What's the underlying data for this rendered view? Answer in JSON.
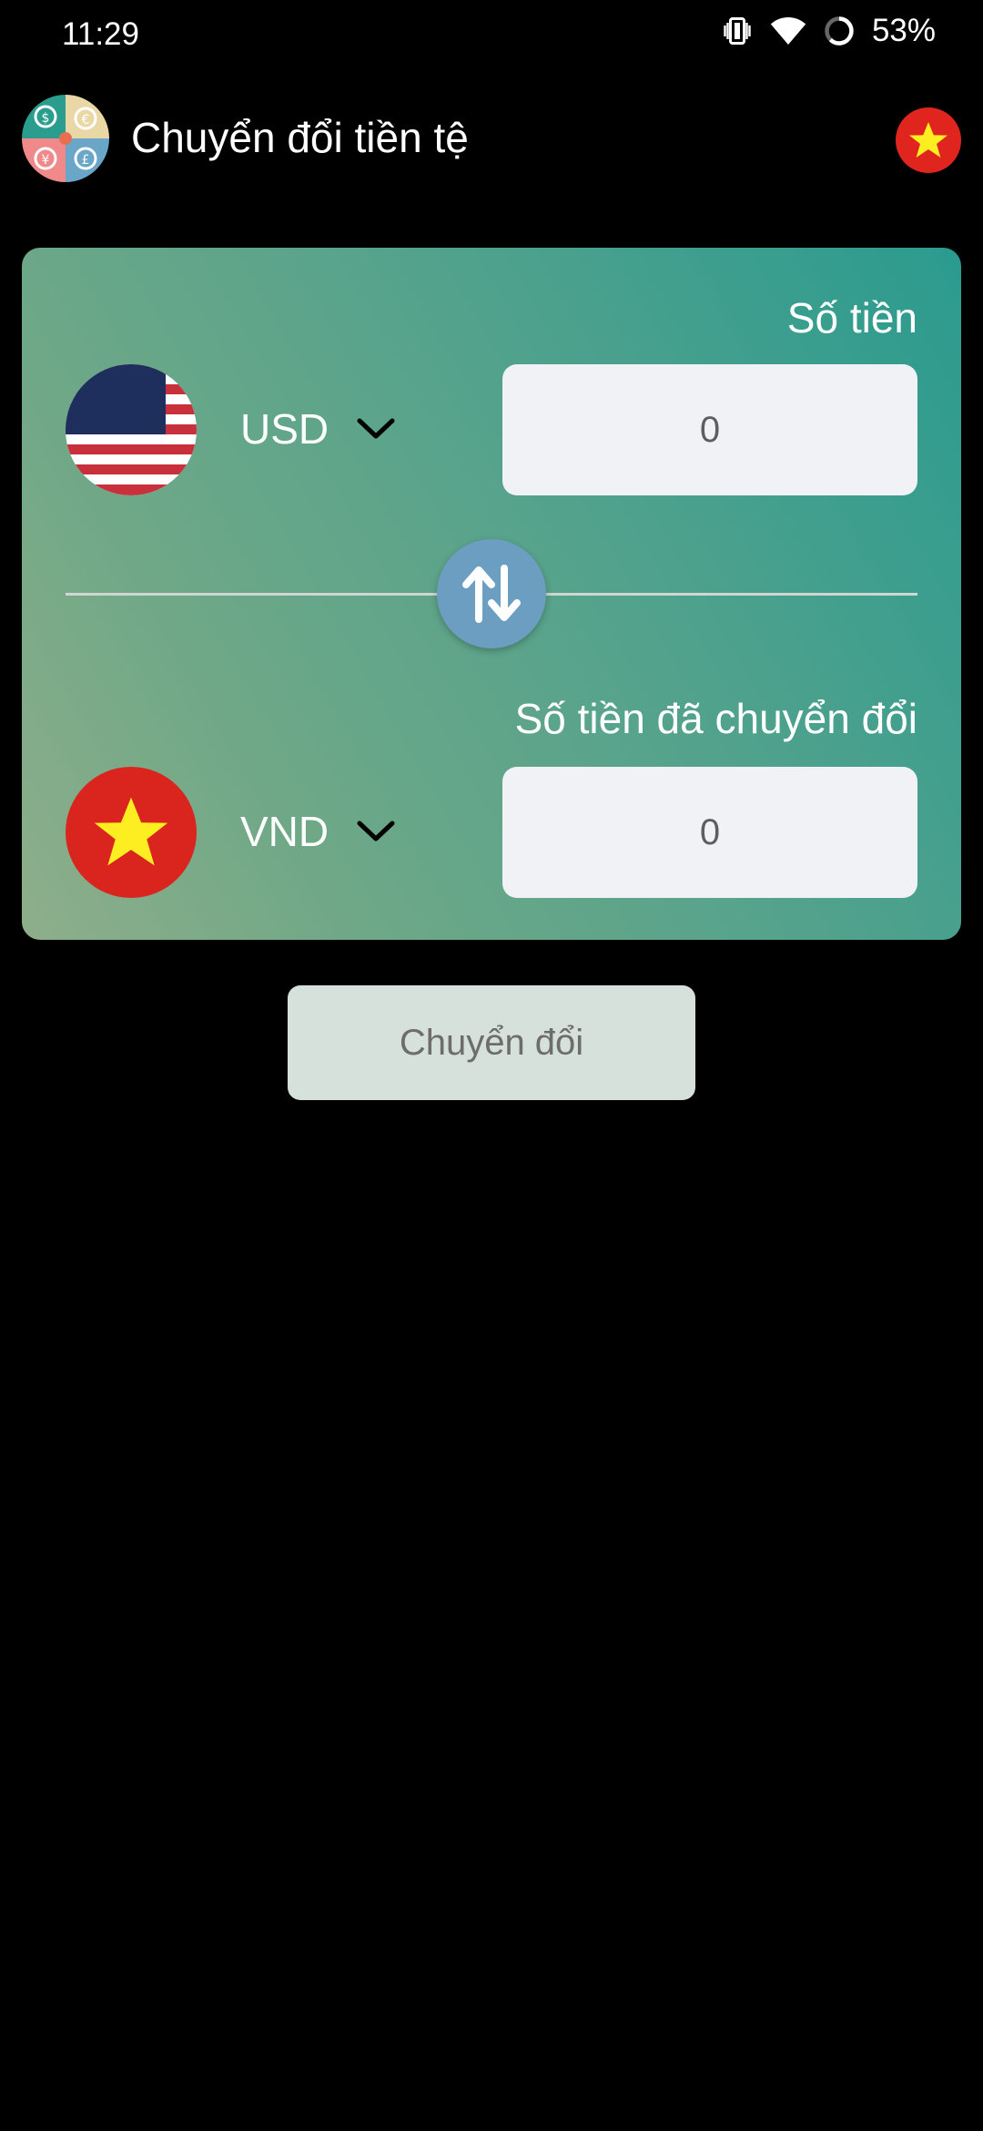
{
  "status_bar": {
    "time": "11:29",
    "battery": "53%",
    "icons": [
      "vibrate-icon",
      "wifi-icon",
      "battery-icon"
    ]
  },
  "app_bar": {
    "title": "Chuyển đổi tiền tệ",
    "logo_icon": "currency-logo-icon",
    "language_flag": "vietnam-flag-icon"
  },
  "converter": {
    "amount_label": "Số tiền",
    "converted_label": "Số tiền đã chuyển đổi",
    "from": {
      "code": "USD",
      "flag": "usa-flag-icon",
      "value": "0"
    },
    "to": {
      "code": "VND",
      "flag": "vietnam-flag-icon",
      "value": "0"
    },
    "swap_icon": "swap-vertical-icon"
  },
  "actions": {
    "convert_label": "Chuyển đổi"
  },
  "colors": {
    "background": "#000000",
    "swap_button": "#6b9ec0",
    "input_bg": "#f1f2f6",
    "convert_button_bg": "#d6e1db",
    "vn_red": "#d9251e",
    "vn_star": "#fcee21"
  }
}
